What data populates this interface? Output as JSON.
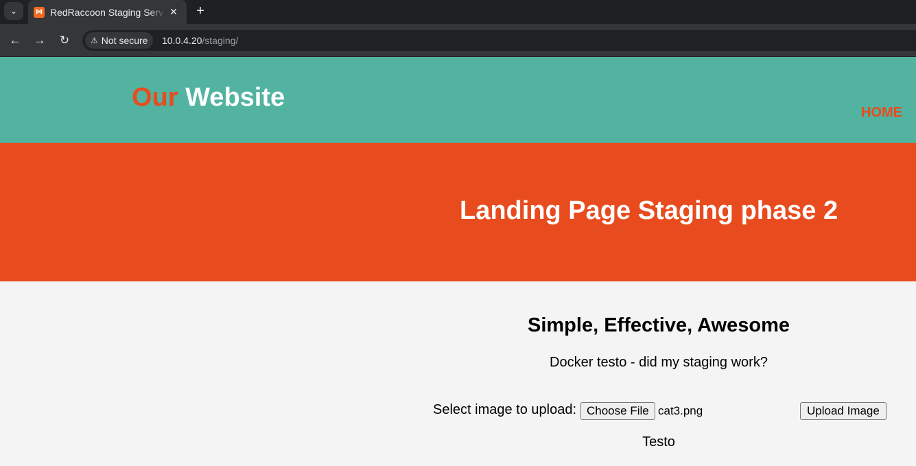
{
  "browser": {
    "tab_title": "RedRaccoon Staging Serv",
    "tab_favicon": "xampp-favicon",
    "security_label": "Not secure",
    "url_host": "10.0.4.20",
    "url_path": "/staging/"
  },
  "header": {
    "logo_part1": "Our",
    "logo_part2": "Website",
    "nav_home": "HOME"
  },
  "hero": {
    "title": "Landing Page Staging phase 2"
  },
  "content": {
    "subtitle": "Simple, Effective, Awesome",
    "description": "Docker testo - did my staging work?",
    "upload_label": "Select image to upload:",
    "choose_file_label": "Choose File",
    "selected_file": "cat3.png",
    "upload_button": "Upload Image",
    "footer_text": "Testo"
  },
  "colors": {
    "header_bg": "#52b3a1",
    "accent": "#e84c1e",
    "page_bg": "#f4f4f4"
  }
}
